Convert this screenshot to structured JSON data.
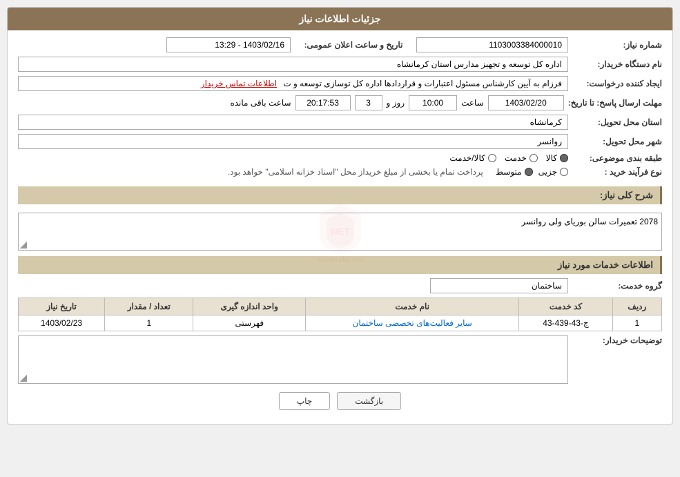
{
  "header": {
    "title": "جزئیات اطلاعات نیاز"
  },
  "fields": {
    "need_number_label": "شماره نیاز:",
    "need_number_value": "1103003384000010",
    "announce_datetime_label": "تاریخ و ساعت اعلان عمومی:",
    "announce_datetime_value": "1403/02/16 - 13:29",
    "buyer_org_label": "نام دستگاه خریدار:",
    "buyer_org_value": "اداره کل توسعه  و تجهیز مدارس استان کرمانشاه",
    "creator_label": "ایجاد کننده درخواست:",
    "creator_value": "فرزام به آیین کارشناس مسئول اعتبارات و قراردادها اداره کل توسازی  توسعه و ت",
    "creator_link": "اطلاعات تماس خریدار",
    "deadline_label": "مهلت ارسال پاسخ: تا تاریخ:",
    "deadline_date": "1403/02/20",
    "deadline_time_label": "ساعت",
    "deadline_time": "10:00",
    "deadline_days_label": "روز و",
    "deadline_days": "3",
    "deadline_remaining_label": "ساعت باقی مانده",
    "deadline_remaining": "20:17:53",
    "province_label": "استان محل تحویل:",
    "province_value": "کرمانشاه",
    "city_label": "شهر محل تحویل:",
    "city_value": "روانسر",
    "category_label": "طبقه بندی موضوعی:",
    "category_options": [
      "کالا",
      "خدمت",
      "کالا/خدمت"
    ],
    "category_selected": "کالا",
    "process_label": "نوع فرآیند خرید :",
    "process_options": [
      "جزیی",
      "متوسط"
    ],
    "process_selected_text": "پرداخت تمام یا بخشی از مبلغ خریداز محل \"اسناد خزانه اسلامی\" خواهد بود.",
    "general_desc_label": "شرح کلی نیاز:",
    "general_desc_value": "2078 تعمیرات سالن بوریای ولی روانسر",
    "services_section_title": "اطلاعات خدمات مورد نیاز",
    "service_group_label": "گروه خدمت:",
    "service_group_value": "ساختمان",
    "table_headers": [
      "ردیف",
      "کد خدمت",
      "نام خدمت",
      "واحد اندازه گیری",
      "تعداد / مقدار",
      "تاریخ نیاز"
    ],
    "table_rows": [
      {
        "row": "1",
        "code": "ج-43-439-43",
        "name": "سایر فعالیت‌های تخصصی ساختمان",
        "unit": "فهرستی",
        "quantity": "1",
        "date": "1403/02/23"
      }
    ],
    "buyer_desc_label": "توضیحات خریدار:",
    "buyer_desc_value": ""
  },
  "buttons": {
    "print_label": "چاپ",
    "back_label": "بازگشت"
  },
  "watermark_text": "anatender.net"
}
